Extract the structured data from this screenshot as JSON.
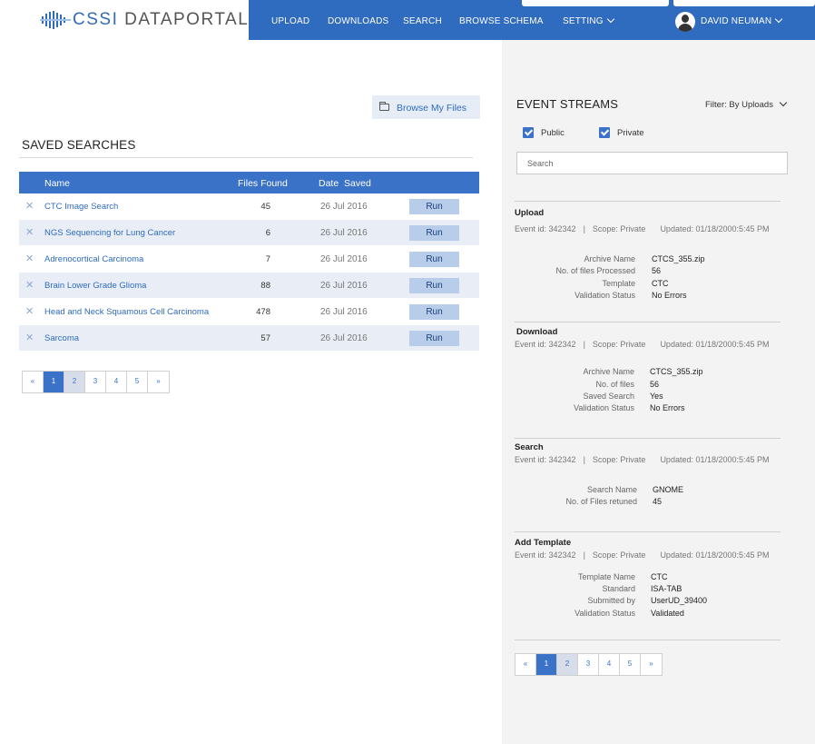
{
  "header": {
    "logo": {
      "part1": "CSSI",
      "part2": "DATAPORTAL"
    },
    "nav": [
      "UPLOAD",
      "DOWNLOADS",
      "SEARCH",
      "BROWSE SCHEMA",
      "SETTING"
    ],
    "user": "DAVID NEUMAN"
  },
  "left": {
    "browse_button": "Browse My Files",
    "saved_title": "SAVED SEARCHES",
    "table": {
      "headers": [
        "Name",
        "Files Found",
        "Date  Saved"
      ],
      "rows": [
        {
          "name": "CTC Image Search",
          "files": "45",
          "date": "26 Jul 2016",
          "action": "Run"
        },
        {
          "name": "NGS Sequencing for Lung Cancer",
          "files": "6",
          "date": "26 Jul 2016",
          "action": "Run"
        },
        {
          "name": "Adrenocortical Carcinoma",
          "files": "7",
          "date": "26 Jul 2016",
          "action": "Run"
        },
        {
          "name": "Brain Lower Grade Glioma",
          "files": "88",
          "date": "26 Jul 2016",
          "action": "Run"
        },
        {
          "name": "Head and Neck Squamous Cell Carcinoma",
          "files": "478",
          "date": "26 Jul 2016",
          "action": "Run"
        },
        {
          "name": "Sarcoma",
          "files": "57",
          "date": "26 Jul 2016",
          "action": "Run"
        }
      ]
    },
    "pager": [
      "«",
      "1",
      "2",
      "3",
      "4",
      "5",
      "»"
    ]
  },
  "right": {
    "title": "EVENT STREAMS",
    "filter": "Filter: By Uploads",
    "checkboxes": {
      "public": "Public",
      "private": "Private"
    },
    "search_placeholder": "Search",
    "events": [
      {
        "type": "Upload",
        "event_id": "Event id: 342342",
        "scope": "Scope: Private",
        "updated": "Updated: 01/18/2000:5:45 PM",
        "fields": [
          {
            "k": "Archive Name",
            "v": "CTCS_355.zip"
          },
          {
            "k": "No. of files Processed",
            "v": "56"
          },
          {
            "k": "Template",
            "v": "CTC"
          },
          {
            "k": "Validation Status",
            "v": "No Errors"
          }
        ]
      },
      {
        "type": "Download",
        "event_id": "Event id: 342342",
        "scope": "Scope: Private",
        "updated": "Updated: 01/18/2000:5:45 PM",
        "fields": [
          {
            "k": "Archive Name",
            "v": "CTCS_355.zip"
          },
          {
            "k": "No. of files",
            "v": "56"
          },
          {
            "k": "Saved Search",
            "v": "Yes"
          },
          {
            "k": "Validation Status",
            "v": "No Errors"
          }
        ]
      },
      {
        "type": "Search",
        "event_id": "Event id: 342342",
        "scope": "Scope: Private",
        "updated": "Updated: 01/18/2000:5:45 PM",
        "fields": [
          {
            "k": "Search Name",
            "v": "GNOME"
          },
          {
            "k": "No. of Files retuned",
            "v": "45"
          }
        ]
      },
      {
        "type": "Add Template",
        "event_id": "Event id: 342342",
        "scope": "Scope: Private",
        "updated": "Updated: 01/18/2000:5:45 PM",
        "fields": [
          {
            "k": "Template Name",
            "v": "CTC"
          },
          {
            "k": "Standard",
            "v": "ISA-TAB"
          },
          {
            "k": "Submitted by",
            "v": "UserUD_39400"
          },
          {
            "k": "Validation Status",
            "v": "Validated"
          }
        ]
      }
    ],
    "pager": [
      "«",
      "1",
      "2",
      "3",
      "4",
      "5",
      "»"
    ]
  }
}
